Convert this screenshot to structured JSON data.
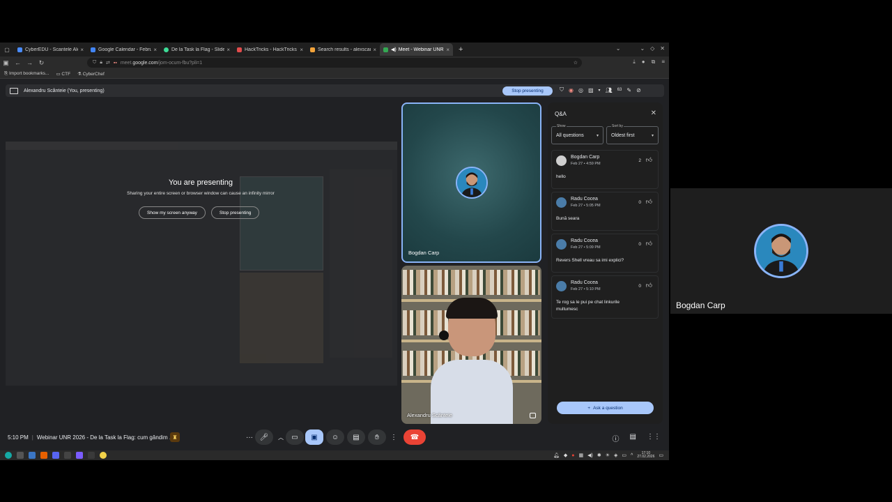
{
  "browser": {
    "tabs": [
      {
        "title": "CyberEDU - Scantele Alex",
        "color": "#4a8cff"
      },
      {
        "title": "Google Calendar - Februar",
        "color": "#4285f4"
      },
      {
        "title": "De la Task la Flag - Slidev",
        "color": "#3ddc97"
      },
      {
        "title": "HackTricks - HackTricks",
        "color": "#e24c4c"
      },
      {
        "title": "Search results - alexscant",
        "color": "#f2a33a"
      },
      {
        "title": "Meet - Webinar UNR 20",
        "color": "#34a853"
      }
    ],
    "new_tab": "+",
    "url": {
      "prefix": "meet.",
      "host": "google.com",
      "path": "/jom-ocum-fbu?pli=1"
    },
    "bookmarks": [
      "Import bookmarks...",
      "CTF",
      "CyberChef"
    ]
  },
  "meet": {
    "presenter_bar": {
      "label": "Alexandru Scânteie (You, presenting)",
      "stop_button": "Stop presenting",
      "participants": "63"
    },
    "presenting": {
      "heading": "You are presenting",
      "subtext": "Sharing your entire screen or browser window can cause an infinity mirror",
      "show_anyway": "Show my screen anyway",
      "stop": "Stop presenting"
    },
    "tiles": [
      {
        "name": "Bogdan Carp"
      },
      {
        "name": "Alexandru Scânteie"
      }
    ],
    "qa": {
      "title": "Q&A",
      "show_label": "Show",
      "show_value": "All questions",
      "sort_label": "Sort by",
      "sort_value": "Oldest first",
      "questions": [
        {
          "author": "Bogdan Carp",
          "date": "Feb 27 • 4:59 PM",
          "votes": "2",
          "text": "hello"
        },
        {
          "author": "Radu Cocea",
          "date": "Feb 27 • 5:05 PM",
          "votes": "0",
          "text": "Bună seara"
        },
        {
          "author": "Radu Cocea",
          "date": "Feb 27 • 5:09 PM",
          "votes": "0",
          "text": "Revers Shell vreau sa imi explici?"
        },
        {
          "author": "Radu Cocea",
          "date": "Feb 27 • 5:10 PM",
          "votes": "0",
          "text": "Te rog sa le pui pe chat linkurile multumesc"
        }
      ],
      "ask_button": "Ask a question"
    },
    "bottom": {
      "time": "5:10 PM",
      "meeting_title": "Webinar UNR 2026 - De la Task la Flag: cum gândim ..."
    }
  },
  "taskbar": {
    "time": "17:10",
    "date": "27.02.2026"
  },
  "side_tile": {
    "name": "Bogdan Carp"
  }
}
